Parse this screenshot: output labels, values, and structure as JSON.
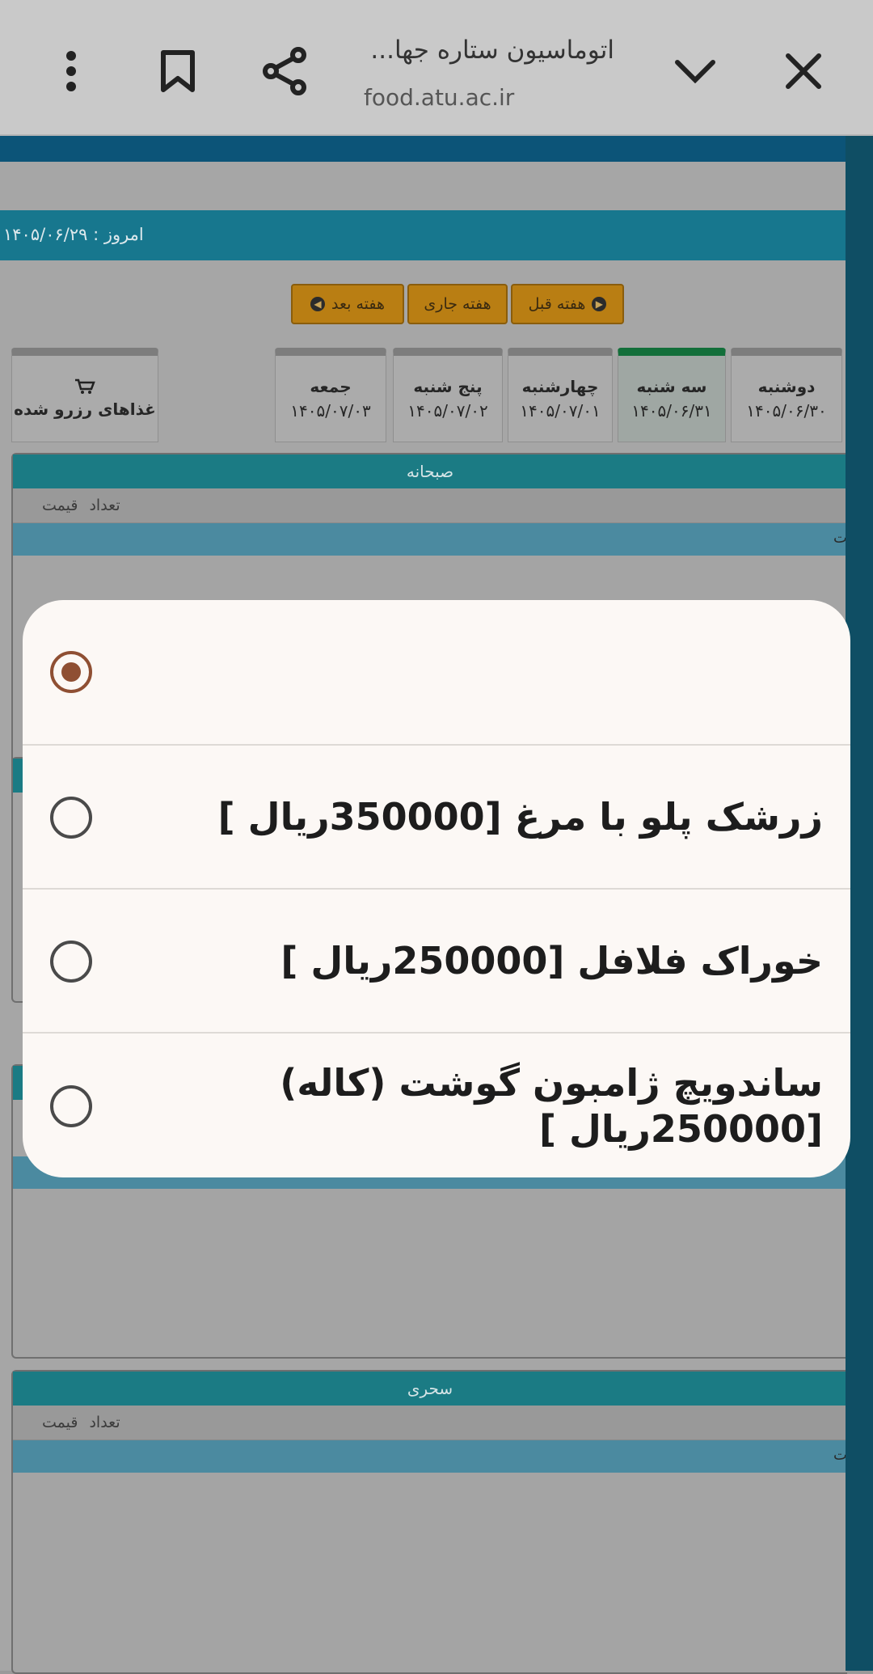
{
  "browser": {
    "title": "اتوماسیون ستاره جها...",
    "url": "food.atu.ac.ir"
  },
  "page": {
    "today": "امروز : ۱۴۰۵/۰۶/۲۹",
    "week_buttons": {
      "prev": "هفته قبل",
      "current": "هفته جاری",
      "next": "هفته بعد"
    },
    "days": [
      {
        "name": "دوشنبه",
        "date": "۱۴۰۵/۰۶/۳۰"
      },
      {
        "name": "سه شنبه",
        "date": "۱۴۰۵/۰۶/۳۱"
      },
      {
        "name": "چهارشنبه",
        "date": "۱۴۰۵/۰۷/۰۱"
      },
      {
        "name": "پنج شنبه",
        "date": "۱۴۰۵/۰۷/۰۲"
      },
      {
        "name": "جمعه",
        "date": "۱۴۰۵/۰۷/۰۳"
      }
    ],
    "reserved_tab": "غذاهای رزرو شده",
    "sections": [
      {
        "title": "صبحانه",
        "col_count": "تعداد",
        "col_price": "قیمت",
        "row_partial": "ت"
      },
      {
        "title": "سحری",
        "col_count": "تعداد",
        "col_price": "قیمت",
        "row_partial": "ت"
      }
    ]
  },
  "dialog": {
    "options": [
      {
        "label": "",
        "selected": true
      },
      {
        "label": "زرشک پلو با مرغ [350000ریال ]",
        "selected": false
      },
      {
        "label": "خوراک فلافل [250000ریال ]",
        "selected": false
      },
      {
        "label": "ساندویچ ژامبون گوشت (کاله) [250000ریال ]",
        "selected": false
      }
    ]
  },
  "colors": {
    "accent_radio": "#8f4f33",
    "week_button": "#b97e13",
    "section_header": "#1b7b84",
    "active_day": "#136f3a"
  }
}
